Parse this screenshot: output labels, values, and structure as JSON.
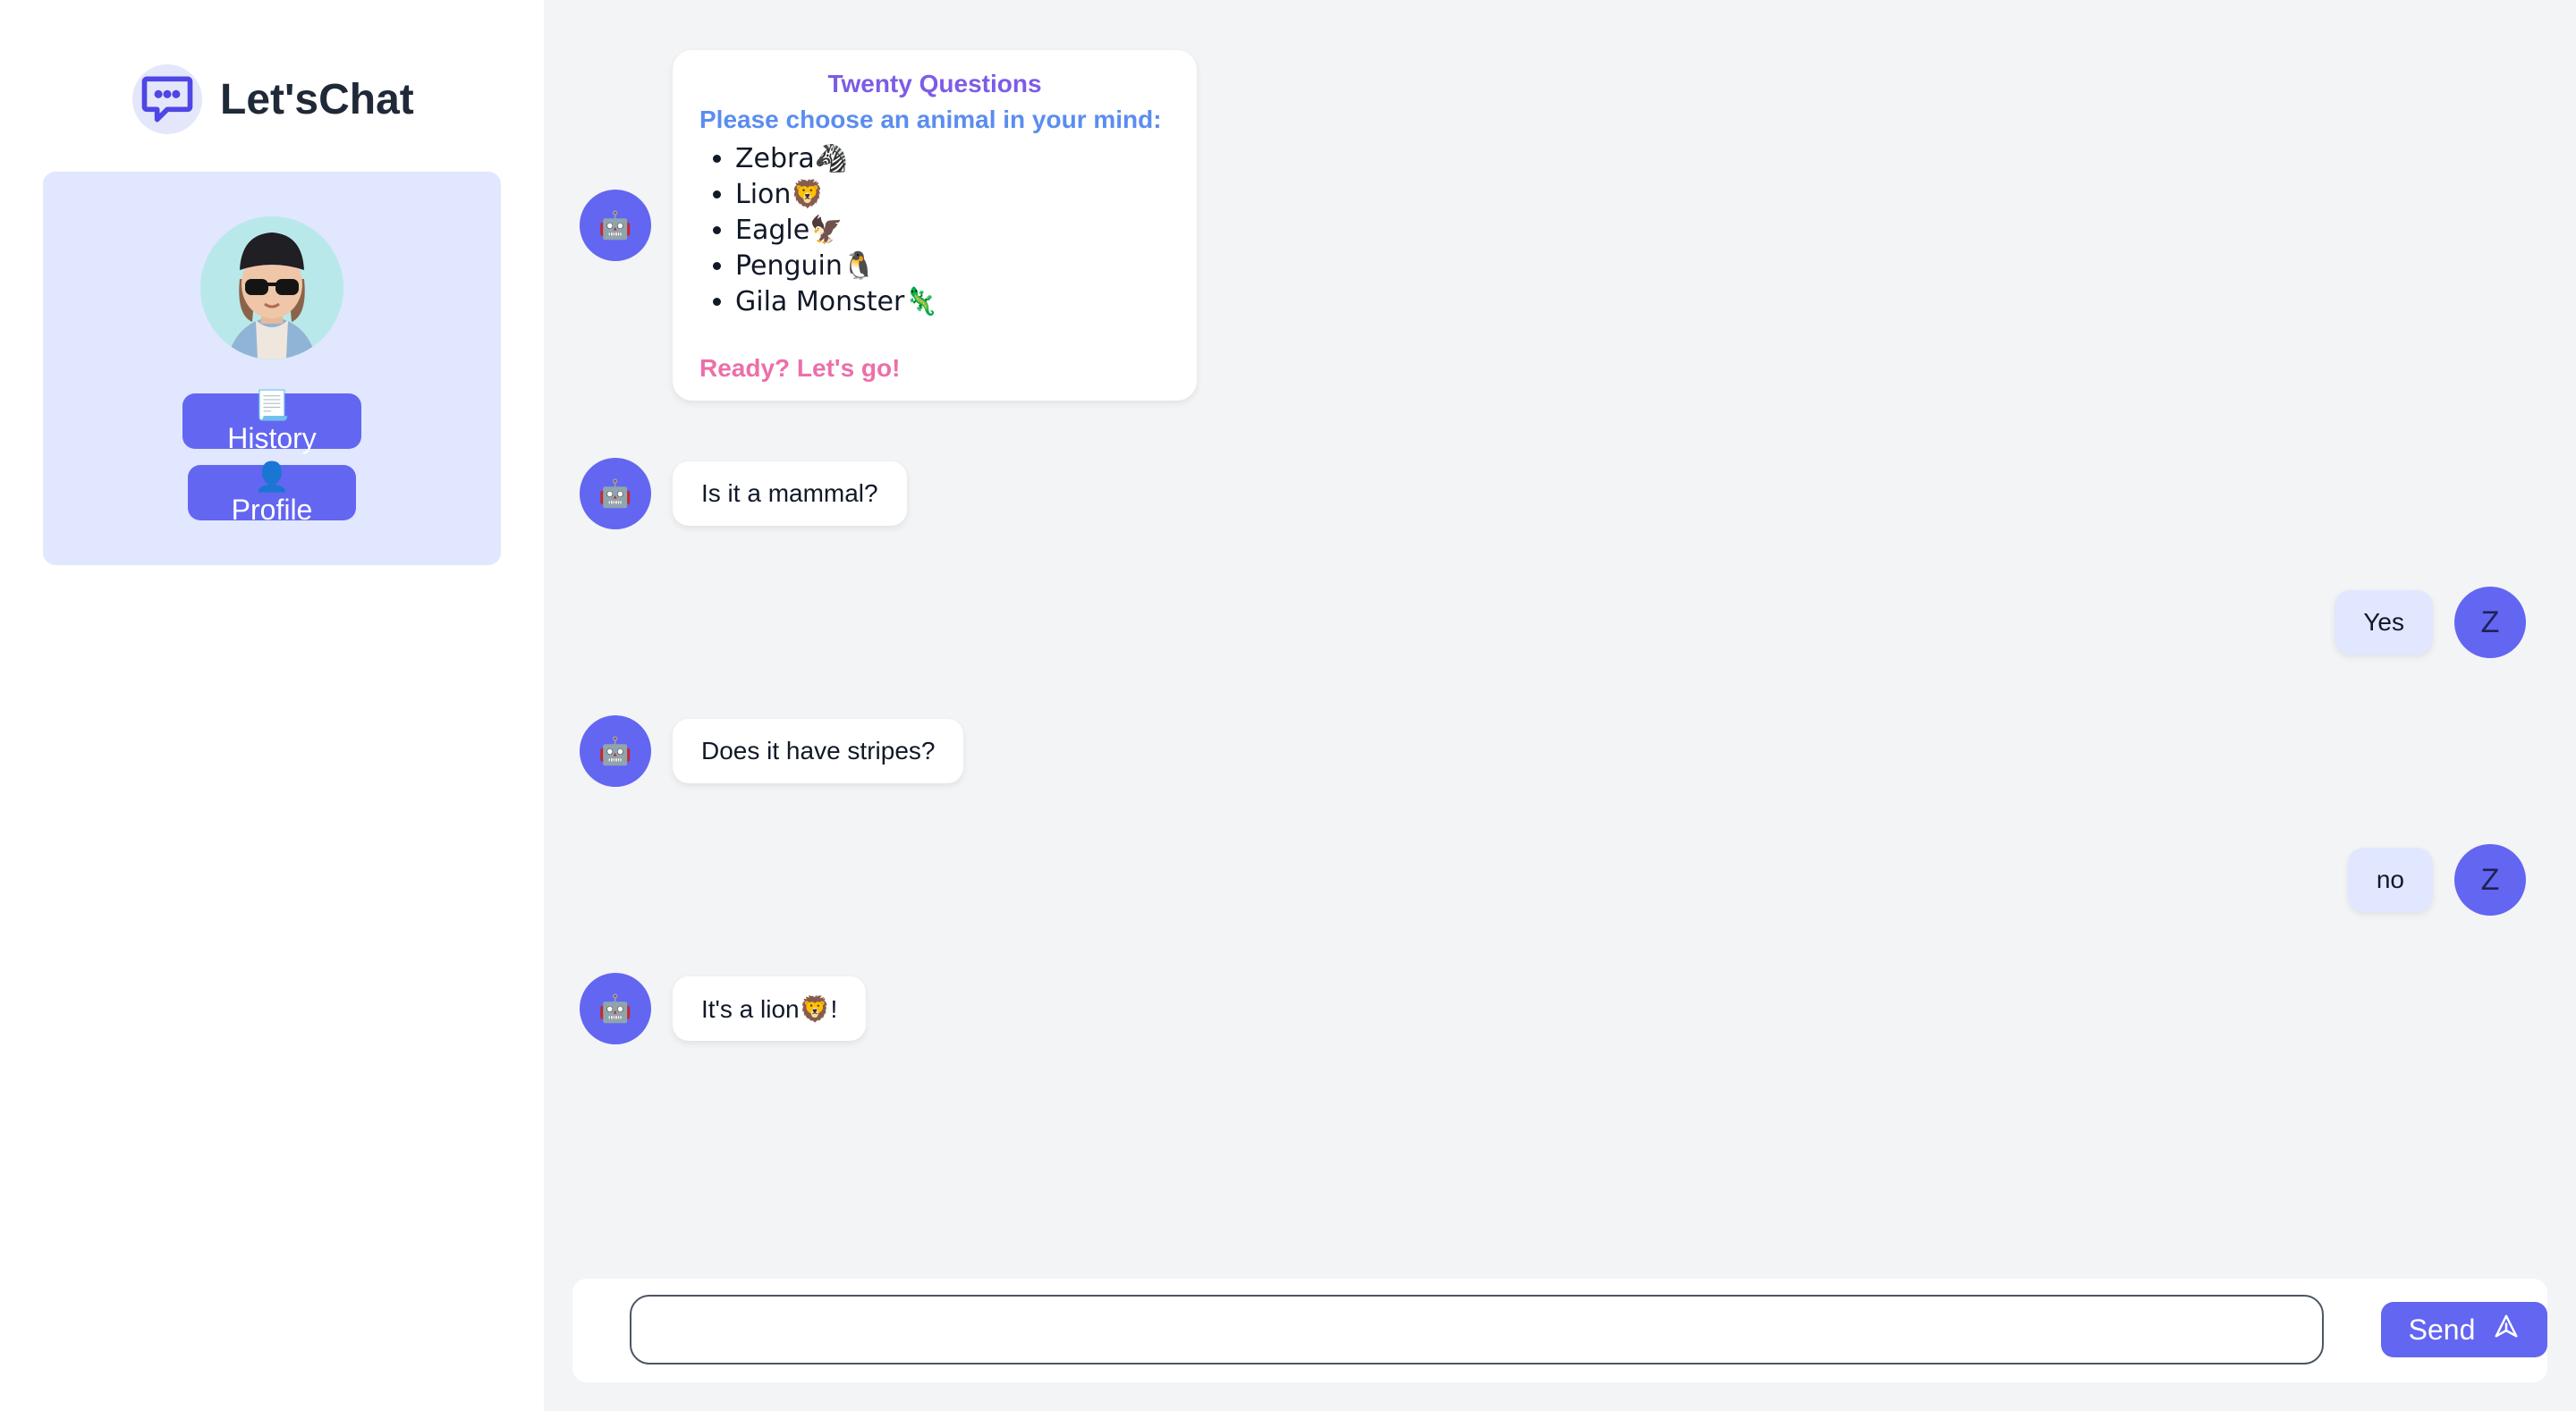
{
  "brand": {
    "name": "Let'sChat"
  },
  "sidebar": {
    "history_label": "📃History",
    "profile_label": "👤Profile"
  },
  "intro": {
    "title": "Twenty Questions",
    "subtitle": "Please choose an animal in your mind:",
    "animals": [
      "Zebra🦓",
      "Lion🦁",
      "Eagle🦅",
      "Penguin🐧",
      "Gila Monster🦎"
    ],
    "ready": "Ready? Let's go!"
  },
  "messages": [
    {
      "from": "bot",
      "text": "Is it a mammal?"
    },
    {
      "from": "user",
      "text": "Yes"
    },
    {
      "from": "bot",
      "text": "Does it have stripes?"
    },
    {
      "from": "user",
      "text": "no"
    },
    {
      "from": "bot",
      "text": "It's a lion🦁!"
    }
  ],
  "user": {
    "initial": "Z"
  },
  "bot": {
    "icon": "🤖"
  },
  "composer": {
    "value": "",
    "placeholder": "",
    "send_label": "Send"
  },
  "colors": {
    "accent": "#6366f1",
    "card": "#e0e7ff",
    "title": "#7c5ce6",
    "subtitle": "#5b8def",
    "ready": "#ec6fa8"
  }
}
